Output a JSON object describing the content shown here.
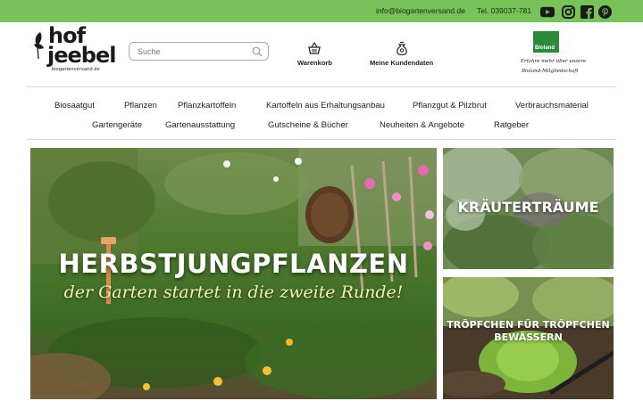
{
  "topbar": {
    "email": "info@biogartenversand.de",
    "phone": "Tel. 039037-781",
    "social": [
      "youtube-icon",
      "instagram-icon",
      "facebook-icon",
      "pinterest-icon"
    ],
    "background": "#78c25a"
  },
  "logo": {
    "line1": "hof",
    "line2": "jeebel",
    "url": "biogartenversand.de"
  },
  "search": {
    "placeholder": "Suche"
  },
  "header": {
    "cart_label": "Warenkorb",
    "account_label": "Meine Kundendaten"
  },
  "bioland": {
    "brand": "Bioland",
    "tagline1": "Erfahre mehr über unsere",
    "tagline2": "Bioland-Mitgliedschaft"
  },
  "nav": {
    "row1": [
      "Biosaatgut",
      "Pflanzen",
      "Pflanzkartoffeln",
      "Kartoffeln aus Erhaltungsanbau",
      "Pflanzgut & Pilzbrut",
      "Verbrauchsmaterial"
    ],
    "row2": [
      "Gartengeräte",
      "Gartenausstattung",
      "Gutscheine & Bücher",
      "Neuheiten & Angebote",
      "Ratgeber"
    ]
  },
  "banners": {
    "hero_title": "HERBSTJUNGPFLANZEN",
    "hero_subtitle": "der Garten startet in die zweite Runde!",
    "side1_title": "KRÄUTERTRÄUME",
    "side2_title_line1": "TRÖPFCHEN FÜR TRÖPFCHEN",
    "side2_title_line2": "BEWÄSSERN"
  }
}
